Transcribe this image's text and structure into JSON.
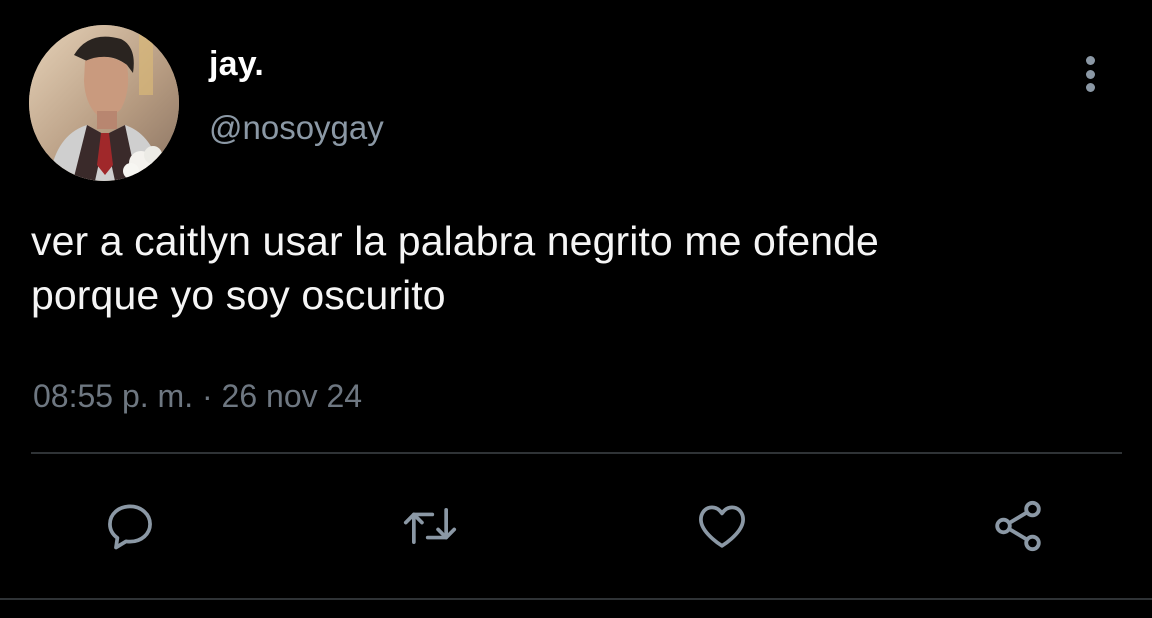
{
  "user": {
    "display_name": "jay.",
    "handle": "@nosoygay"
  },
  "tweet": {
    "text": "ver a caitlyn usar la palabra negrito me ofende\nporque yo soy oscurito",
    "time": "08:55 p. m.",
    "separator": "·",
    "date": "26 nov 24"
  },
  "actions": [
    {
      "icon": "reply-icon"
    },
    {
      "icon": "retweet-icon"
    },
    {
      "icon": "like-icon"
    },
    {
      "icon": "share-icon"
    }
  ],
  "colors": {
    "background": "#000000",
    "primary_text": "#e7e9ea",
    "secondary_text": "#8b98a5",
    "icon": "#8b98a5",
    "divider": "#2f3336"
  }
}
